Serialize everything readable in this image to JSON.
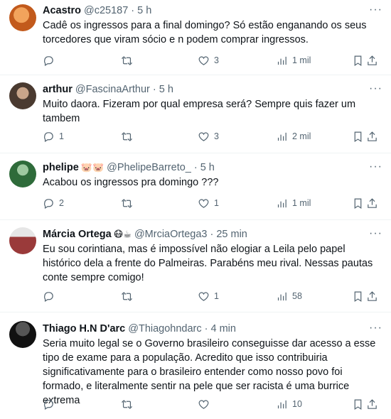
{
  "tweets": [
    {
      "name": "Acastro",
      "emoji": "",
      "handle": "@c25187",
      "time": "5 h",
      "text": "Cadê os ingressos para a final domingo? Só estão enganando os seus torcedores que viram sócio e n podem comprar ingressos.",
      "replies": "",
      "retweets": "",
      "likes": "3",
      "views": "1 mil",
      "avatar_color": "#d9772b"
    },
    {
      "name": "arthur",
      "emoji": "",
      "handle": "@FascinaArthur",
      "time": "5 h",
      "text": "Muito daora. Fizeram por qual empresa será? Sempre quis fazer um tambem",
      "replies": "1",
      "retweets": "",
      "likes": "3",
      "views": "2 mil",
      "avatar_color": "#6b5a4e"
    },
    {
      "name": "phelipe",
      "emoji": "🐷🐷",
      "handle": "@PhelipeBarreto_",
      "time": "5 h",
      "text": "Acabou os ingressos pra domingo ???",
      "replies": "2",
      "retweets": "",
      "likes": "1",
      "views": "1 mil",
      "avatar_color": "#2e6b3a"
    },
    {
      "name": "Márcia Ortega",
      "emoji": "😷☕",
      "handle": "@MrciaOrtega3",
      "time": "25 min",
      "text": "Eu sou corintiana, mas é impossível não elogiar a Leila pelo papel histórico dela a frente do Palmeiras. Parabéns meu rival. Nessas pautas conte sempre comigo!",
      "replies": "",
      "retweets": "",
      "likes": "1",
      "views": "58",
      "avatar_color": "#9a3a3a"
    },
    {
      "name": "Thiago H.N D'arc",
      "emoji": "",
      "handle": "@Thiagohndarc",
      "time": "4 min",
      "text": "Seria muito legal se o Governo brasileiro conseguisse dar acesso a esse tipo de exame para a população. Acredito que isso contribuiria significativamente para o brasileiro entender como nosso povo foi formado, e literalmente sentir na pele que ser racista é uma burrice extrema",
      "replies": "",
      "retweets": "",
      "likes": "",
      "views": "10",
      "avatar_color": "#1e1e1e"
    }
  ],
  "more_glyph": "···"
}
